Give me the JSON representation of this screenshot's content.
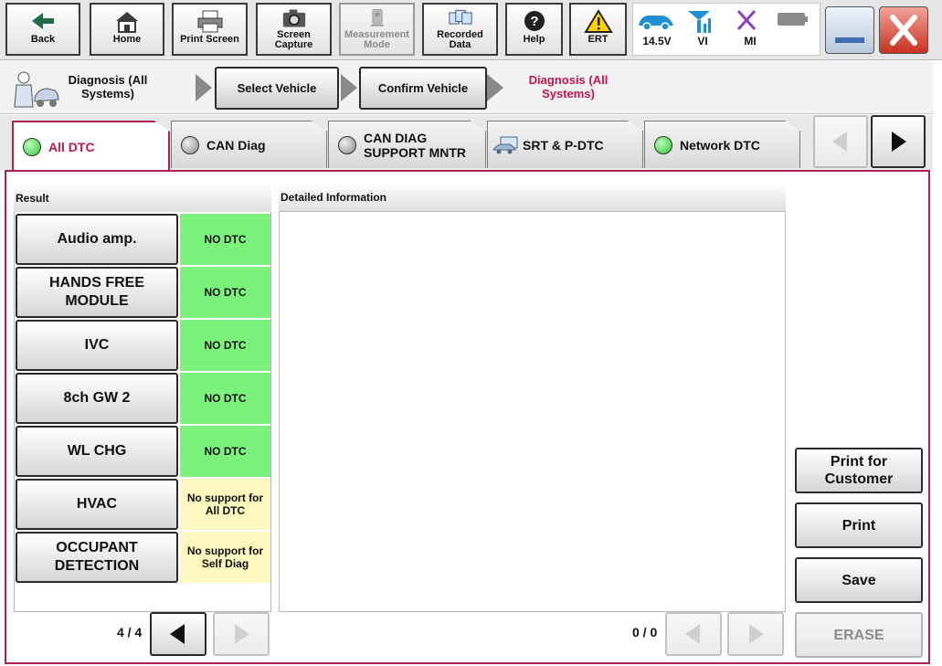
{
  "toolbar": {
    "buttons": [
      {
        "label": "Back",
        "icon": "back-arrow-icon"
      },
      {
        "label": "Home",
        "icon": "home-icon"
      },
      {
        "label": "Print Screen",
        "icon": "printer-icon"
      },
      {
        "label": "Screen Capture",
        "icon": "camera-icon"
      },
      {
        "label": "Measurement Mode",
        "icon": "measurement-icon"
      },
      {
        "label": "Recorded Data",
        "icon": "recorded-data-icon"
      },
      {
        "label": "Help",
        "icon": "help-icon"
      },
      {
        "label": "ERT",
        "icon": "warning-icon"
      }
    ],
    "status": {
      "battery_voltage": "14.5V",
      "vi": "VI",
      "mi": "MI"
    }
  },
  "nav": {
    "current_section": "Diagnosis (All Systems)",
    "steps": [
      "Select Vehicle",
      "Confirm Vehicle"
    ],
    "active_step": "Diagnosis (All Systems)"
  },
  "tabs": [
    {
      "label": "All DTC",
      "led": "green",
      "active": true
    },
    {
      "label": "CAN Diag",
      "led": "gray"
    },
    {
      "label": "CAN DIAG SUPPORT MNTR",
      "led": "gray"
    },
    {
      "label": "SRT & P-DTC",
      "led": "none",
      "icon": "srt-icon"
    },
    {
      "label": "Network DTC",
      "led": "green"
    }
  ],
  "result": {
    "header": "Result",
    "rows": [
      {
        "system": "Audio amp.",
        "status": "NO DTC",
        "state": "ok"
      },
      {
        "system": "HANDS FREE MODULE",
        "status": "NO DTC",
        "state": "ok"
      },
      {
        "system": "IVC",
        "status": "NO DTC",
        "state": "ok"
      },
      {
        "system": "8ch GW 2",
        "status": "NO DTC",
        "state": "ok"
      },
      {
        "system": "WL CHG",
        "status": "NO DTC",
        "state": "ok"
      },
      {
        "system": "HVAC",
        "status": "No support for All DTC",
        "state": "nosupport"
      },
      {
        "system": "OCCUPANT DETECTION",
        "status": "No support for Self Diag",
        "state": "nosupport"
      }
    ],
    "page": "4 / 4"
  },
  "detail": {
    "header": "Detailed Information",
    "page": "0 / 0"
  },
  "actions": {
    "print_customer": "Print for Customer",
    "print": "Print",
    "save": "Save",
    "erase": "ERASE"
  },
  "colors": {
    "accent": "#b0224b",
    "ok_green": "#7cf27c",
    "nosupport_yellow": "#fff7c0"
  }
}
